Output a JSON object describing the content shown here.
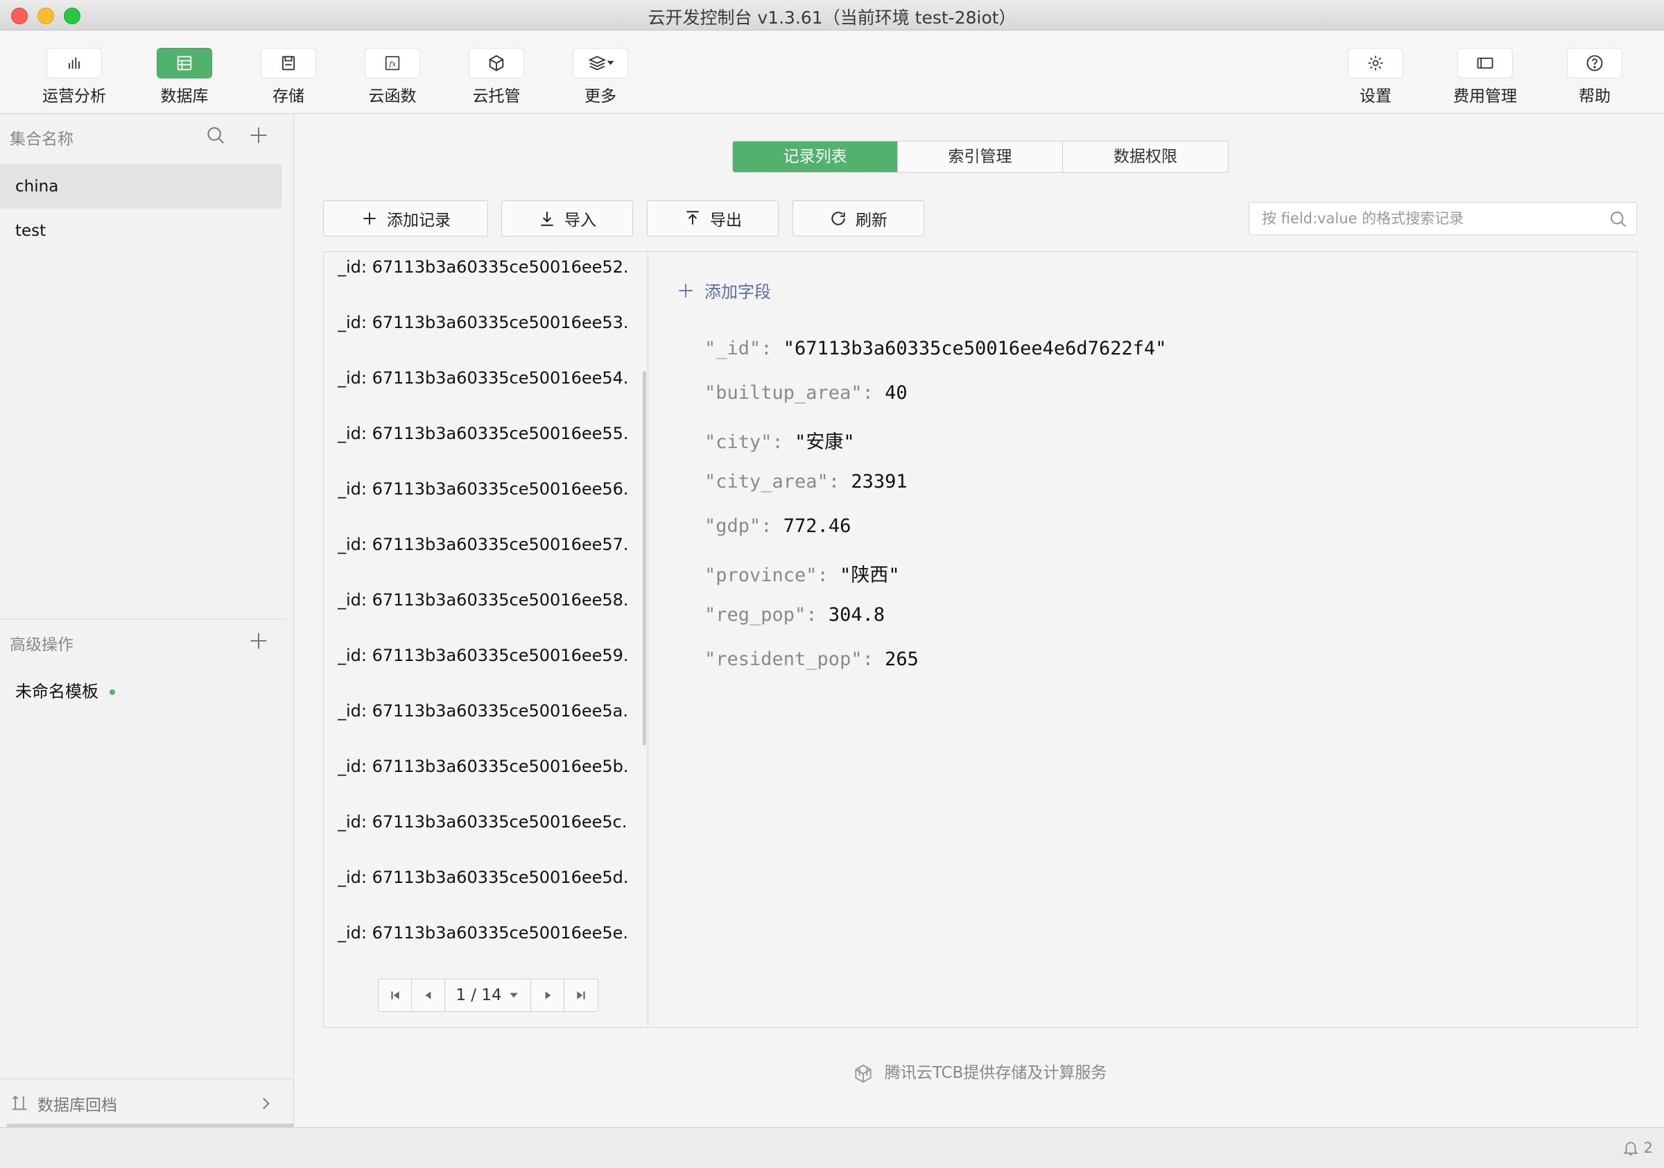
{
  "window": {
    "title": "云开发控制台 v1.3.61（当前环境 test-28iot）"
  },
  "toolbar": {
    "left": [
      {
        "label": "运营分析",
        "icon": "bar-chart-icon"
      },
      {
        "label": "数据库",
        "icon": "table-icon",
        "active": true
      },
      {
        "label": "存储",
        "icon": "storage-icon"
      },
      {
        "label": "云函数",
        "icon": "function-icon"
      },
      {
        "label": "云托管",
        "icon": "cube-icon"
      },
      {
        "label": "更多",
        "icon": "layers-icon"
      }
    ],
    "right": [
      {
        "label": "设置",
        "icon": "gear-icon"
      },
      {
        "label": "费用管理",
        "icon": "billing-icon"
      },
      {
        "label": "帮助",
        "icon": "help-icon"
      }
    ]
  },
  "sidebar": {
    "collections_header": "集合名称",
    "collections": [
      "china",
      "test"
    ],
    "selected_collection": "china",
    "advanced_header": "高级操作",
    "templates": [
      "未命名模板"
    ],
    "rollback_label": "数据库回档"
  },
  "main": {
    "tabs": [
      "记录列表",
      "索引管理",
      "数据权限"
    ],
    "active_tab": "记录列表",
    "actions": {
      "add": "添加记录",
      "import": "导入",
      "export": "导出",
      "refresh": "刷新"
    },
    "search_placeholder": "按 field:value 的格式搜索记录",
    "records": [
      "_id: 67113b3a60335ce50016ee52...",
      "_id: 67113b3a60335ce50016ee53...",
      "_id: 67113b3a60335ce50016ee54...",
      "_id: 67113b3a60335ce50016ee55...",
      "_id: 67113b3a60335ce50016ee56...",
      "_id: 67113b3a60335ce50016ee57...",
      "_id: 67113b3a60335ce50016ee58...",
      "_id: 67113b3a60335ce50016ee59...",
      "_id: 67113b3a60335ce50016ee5a...",
      "_id: 67113b3a60335ce50016ee5b...",
      "_id: 67113b3a60335ce50016ee5c...",
      "_id: 67113b3a60335ce50016ee5d...",
      "_id: 67113b3a60335ce50016ee5e..."
    ],
    "pager": {
      "current": "1 / 14"
    },
    "add_field_label": "添加字段",
    "fields": [
      {
        "key": "\"_id\"",
        "value": "\"67113b3a60335ce50016ee4e6d7622f4\""
      },
      {
        "key": "\"builtup_area\"",
        "value": "40"
      },
      {
        "key": "\"city\"",
        "value": "\"安康\""
      },
      {
        "key": "\"city_area\"",
        "value": "23391"
      },
      {
        "key": "\"gdp\"",
        "value": "772.46"
      },
      {
        "key": "\"province\"",
        "value": "\"陕西\""
      },
      {
        "key": "\"reg_pop\"",
        "value": "304.8"
      },
      {
        "key": "\"resident_pop\"",
        "value": "265"
      }
    ],
    "footer": "腾讯云TCB提供存储及计算服务"
  },
  "statusbar": {
    "notifications": "2"
  },
  "colors": {
    "accent": "#50b26d",
    "link": "#5b6ea1"
  }
}
